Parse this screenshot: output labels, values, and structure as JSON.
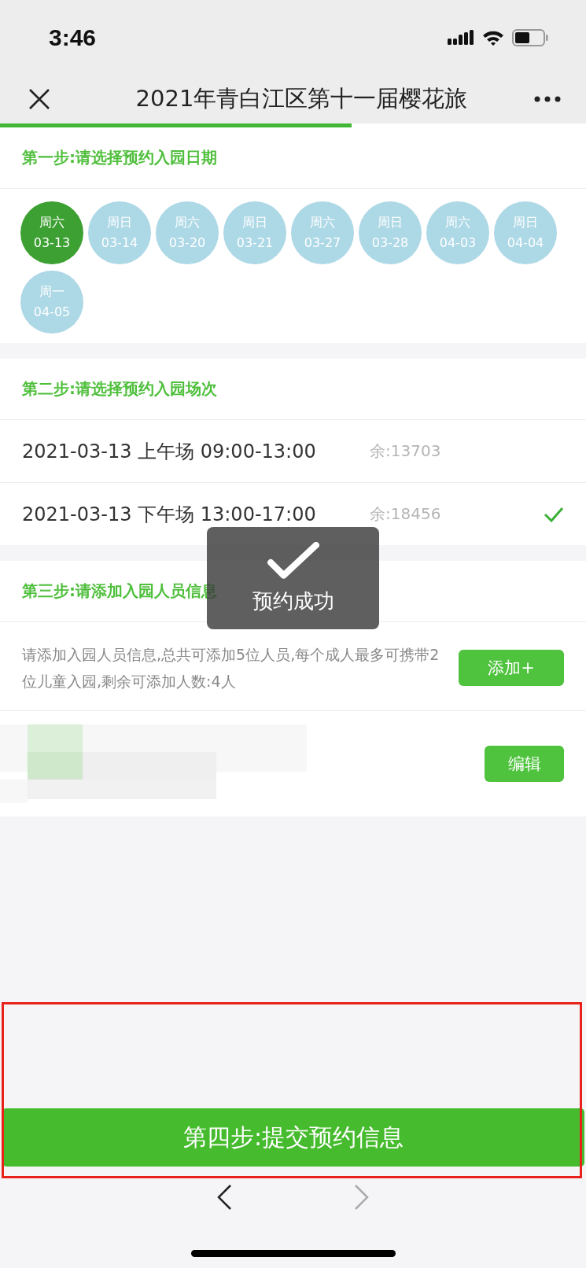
{
  "status_bar": {
    "time": "3:46"
  },
  "nav": {
    "title": "2021年青白江区第十一届樱花旅",
    "progress": {
      "level": 0.6
    }
  },
  "step1": {
    "title": "第一步:请选择预约入园日期",
    "dates": [
      {
        "weekday": "周六",
        "date": "03-13",
        "selected": true
      },
      {
        "weekday": "周日",
        "date": "03-14",
        "selected": false
      },
      {
        "weekday": "周六",
        "date": "03-20",
        "selected": false
      },
      {
        "weekday": "周日",
        "date": "03-21",
        "selected": false
      },
      {
        "weekday": "周六",
        "date": "03-27",
        "selected": false
      },
      {
        "weekday": "周日",
        "date": "03-28",
        "selected": false
      },
      {
        "weekday": "周六",
        "date": "04-03",
        "selected": false
      },
      {
        "weekday": "周日",
        "date": "04-04",
        "selected": false
      },
      {
        "weekday": "周一",
        "date": "04-05",
        "selected": false
      }
    ]
  },
  "step2": {
    "title": "第二步:请选择预约入园场次",
    "sessions": [
      {
        "label": "2021-03-13 上午场 09:00-13:00",
        "remaining": "余:13703",
        "selected": false
      },
      {
        "label": "2021-03-13 下午场 13:00-17:00",
        "remaining": "余:18456",
        "selected": true
      }
    ]
  },
  "step3": {
    "title": "第三步:请添加入园人员信息",
    "note": "请添加入园人员信息,总共可添加5位人员,每个成人最多可携带2位儿童入园,剩余可添加人数:4人",
    "add_button": "添加+",
    "person": {
      "kind": "picture",
      "edit_button": "编辑"
    }
  },
  "submit_button": "第四步:提交预约信息",
  "toast": {
    "message": "预约成功"
  }
}
